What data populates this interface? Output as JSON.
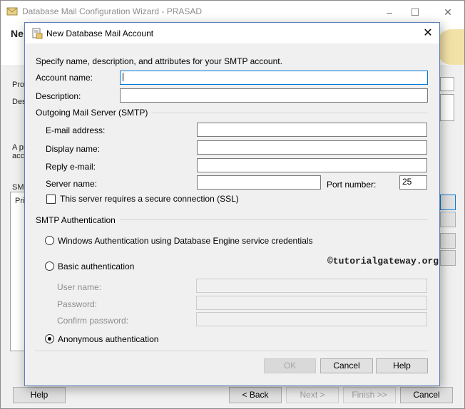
{
  "background_window": {
    "title": "Database Mail Configuration Wizard - PRASAD",
    "heading": "Ne",
    "side_labels": [
      "Prof",
      "Des",
      "A pr",
      "acc",
      "SMT",
      "Prio"
    ],
    "footer": {
      "help_label": "Help",
      "back_label": "< Back",
      "next_label": "Next >",
      "finish_label": "Finish >>",
      "cancel_label": "Cancel"
    }
  },
  "dialog": {
    "title": "New Database Mail Account",
    "instructions": "Specify name, description, and attributes for your SMTP account.",
    "account_name": {
      "label": "Account name:",
      "value": ""
    },
    "description": {
      "label": "Description:",
      "value": ""
    },
    "outgoing": {
      "group_title": "Outgoing Mail Server (SMTP)",
      "email": {
        "label": "E-mail address:",
        "value": ""
      },
      "display_name": {
        "label": "Display name:",
        "value": ""
      },
      "reply_email": {
        "label": "Reply e-mail:",
        "value": ""
      },
      "server_name": {
        "label": "Server name:",
        "value": ""
      },
      "port": {
        "label": "Port number:",
        "value": "25"
      },
      "ssl": {
        "label": "This server requires a secure connection (SSL)",
        "checked": false
      }
    },
    "auth": {
      "group_title": "SMTP Authentication",
      "windows": {
        "label": "Windows Authentication using Database Engine service credentials",
        "selected": false
      },
      "basic": {
        "label": "Basic authentication",
        "selected": false
      },
      "user_name": {
        "label": "User name:",
        "value": ""
      },
      "password": {
        "label": "Password:",
        "value": ""
      },
      "confirm_password": {
        "label": "Confirm password:",
        "value": ""
      },
      "anonymous": {
        "label": "Anonymous authentication",
        "selected": true
      }
    },
    "watermark": "©tutorialgateway.org",
    "buttons": {
      "ok": "OK",
      "cancel": "Cancel",
      "help": "Help"
    }
  }
}
